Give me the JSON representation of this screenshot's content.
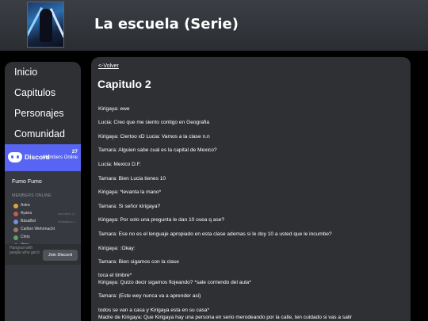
{
  "header": {
    "title": "La escuela (Serie)"
  },
  "sidebar": {
    "items": [
      {
        "label": "Inicio"
      },
      {
        "label": "Capitulos"
      },
      {
        "label": "Personajes"
      },
      {
        "label": "Comunidad"
      }
    ]
  },
  "discord": {
    "brand": "Discord",
    "count": "27",
    "count_label": "Members Online",
    "server_name": "Fumo Fumo",
    "section_label": "MEMBERS ONLINE",
    "members": [
      {
        "name": "Astra",
        "status": "",
        "color": "#e0a33b"
      },
      {
        "name": "Ayana",
        "status": "ayanebot | i...",
        "color": "#c45a5a"
      },
      {
        "name": "BäsaBot",
        "status": "/botstatus s...",
        "color": "#7b8cde"
      },
      {
        "name": "Carlton Wehrmacht",
        "status": "",
        "color": "#9a7b5f"
      },
      {
        "name": "Chris",
        "status": "",
        "color": "#5fa06b"
      },
      {
        "name": "dero",
        "status": "Team V",
        "color": "#a05fa0"
      }
    ],
    "footer_text": "Hangout with people who get it",
    "join_label": "Join Discord"
  },
  "main": {
    "back_label": "<-Volver",
    "chapter_title": "Capitulo 2",
    "lines": [
      "Kirigaya: ewe",
      "Lucia: Creo que me siento contigo en Geografia",
      "Kirigaya: Ciertoo xD Lucia: Vamos a la clase n.n",
      "Tamara: Alguien sabe cual es la capital de Mexico?",
      "Lucia: Mexico D.F.",
      "Tamara: Bien Lucia tienes 10",
      "Kirigaya: *levanta la mano*",
      "Tamara: Si señor kirigaya?",
      "Kirigaya: Por solo una pregunta le dan 10 osea q ase?",
      "Tamara: Ese no es el lenguaje apropiado en esta clase ademas si le doy 10 a usted que le incumbe?",
      "Kirigaya: :Okay:",
      "Tamara: Bien sigamos con la clase",
      "toca el timbre*",
      "Kirigaya: Quizo decir sigamos flojeando? *sale corriendo del aula*",
      "Tamara: (Este wey nunca va a aprender asi)",
      "todos se van a casa y Kirigaya esta en su casa*",
      "Madre de Kirigaya: Que Kirigaya hay una persona en serio merodeando por la calle, ten cuidado si vas a salir"
    ]
  }
}
